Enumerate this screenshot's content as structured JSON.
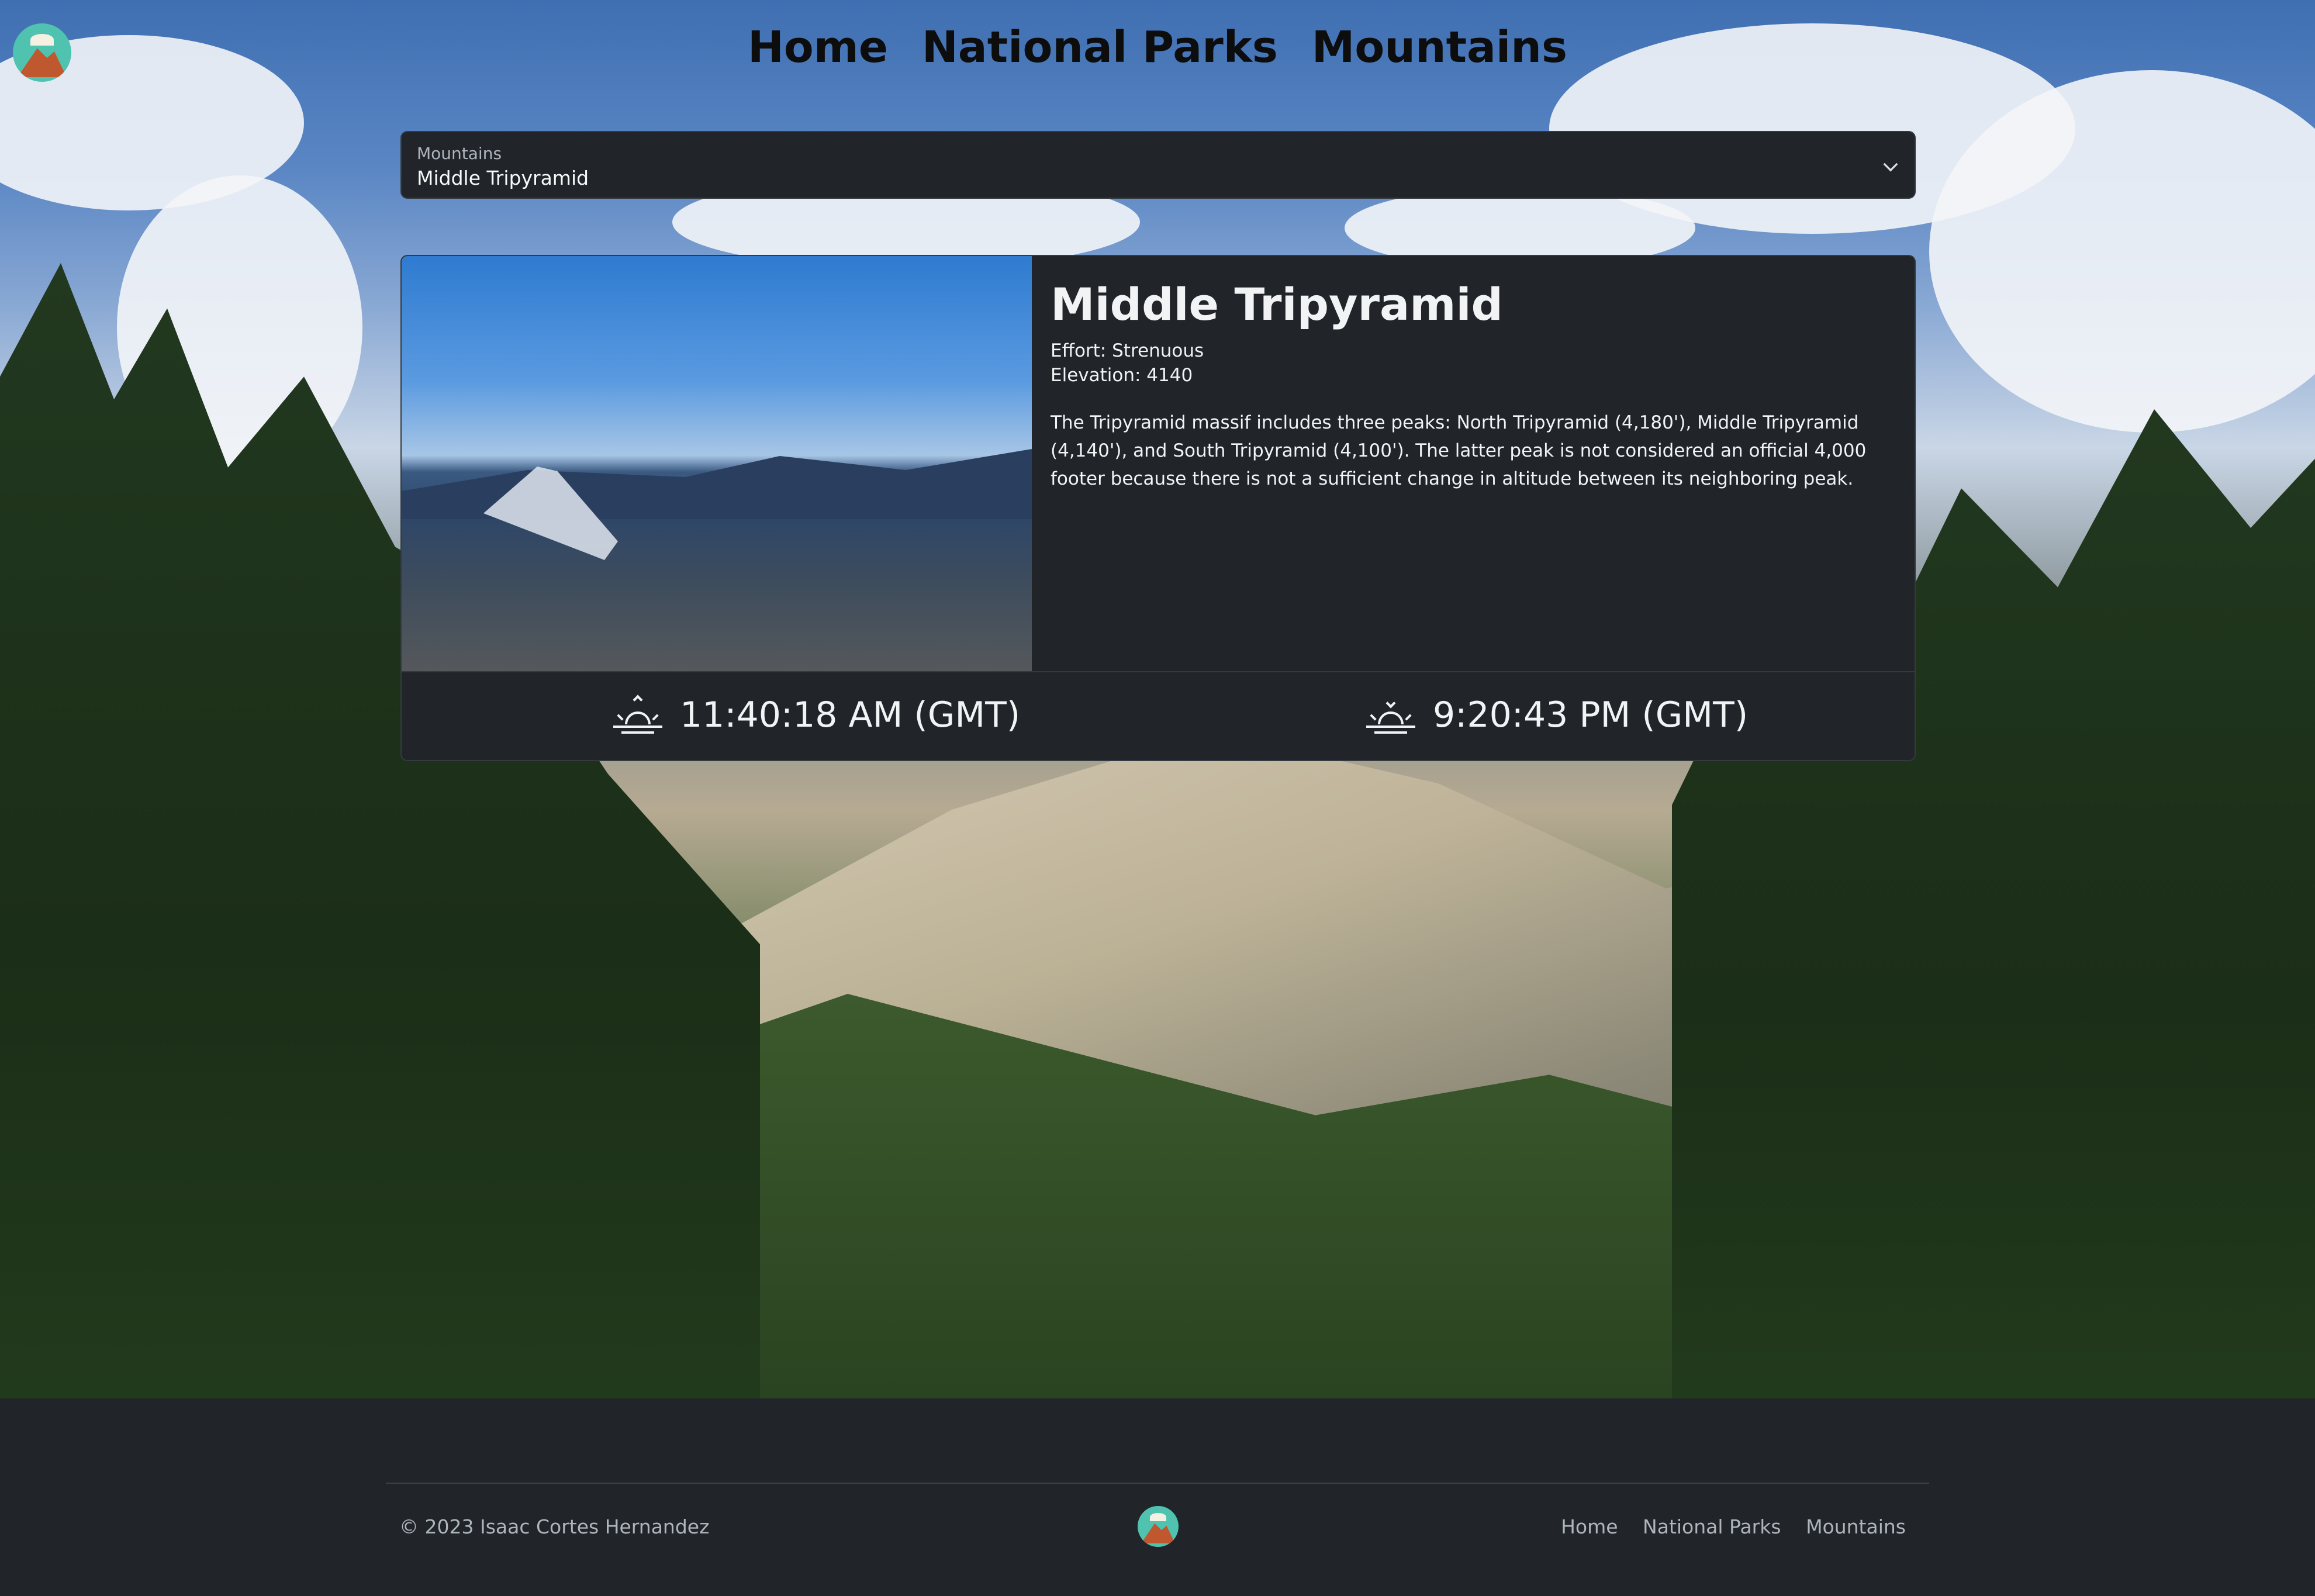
{
  "nav": {
    "home": "Home",
    "national_parks": "National Parks",
    "mountains": "Mountains"
  },
  "select": {
    "label": "Mountains",
    "value": "Middle Tripyramid"
  },
  "card": {
    "title": "Middle Tripyramid",
    "effort": "Effort: Strenuous",
    "elevation": "Elevation: 4140",
    "description": "The Tripyramid massif includes three peaks: North Tripyramid (4,180'), Middle Tripyramid (4,140'), and South Tripyramid (4,100'). The latter peak is not considered an official 4,000 footer because there is not a sufficient change in altitude between its neighboring peak.",
    "sunrise": "11:40:18 AM (GMT)",
    "sunset": "9:20:43 PM (GMT)"
  },
  "footer": {
    "copyright": "© 2023 Isaac Cortes Hernandez",
    "links": {
      "home": "Home",
      "national_parks": "National Parks",
      "mountains": "Mountains"
    }
  },
  "icons": {
    "logo": "mountain-logo-icon",
    "sunrise": "sunrise-icon",
    "sunset": "sunset-icon",
    "dropdown": "chevron-down-icon"
  },
  "colors": {
    "panel": "#212529",
    "text": "#f1f3f5",
    "muted": "#adb5bd"
  }
}
